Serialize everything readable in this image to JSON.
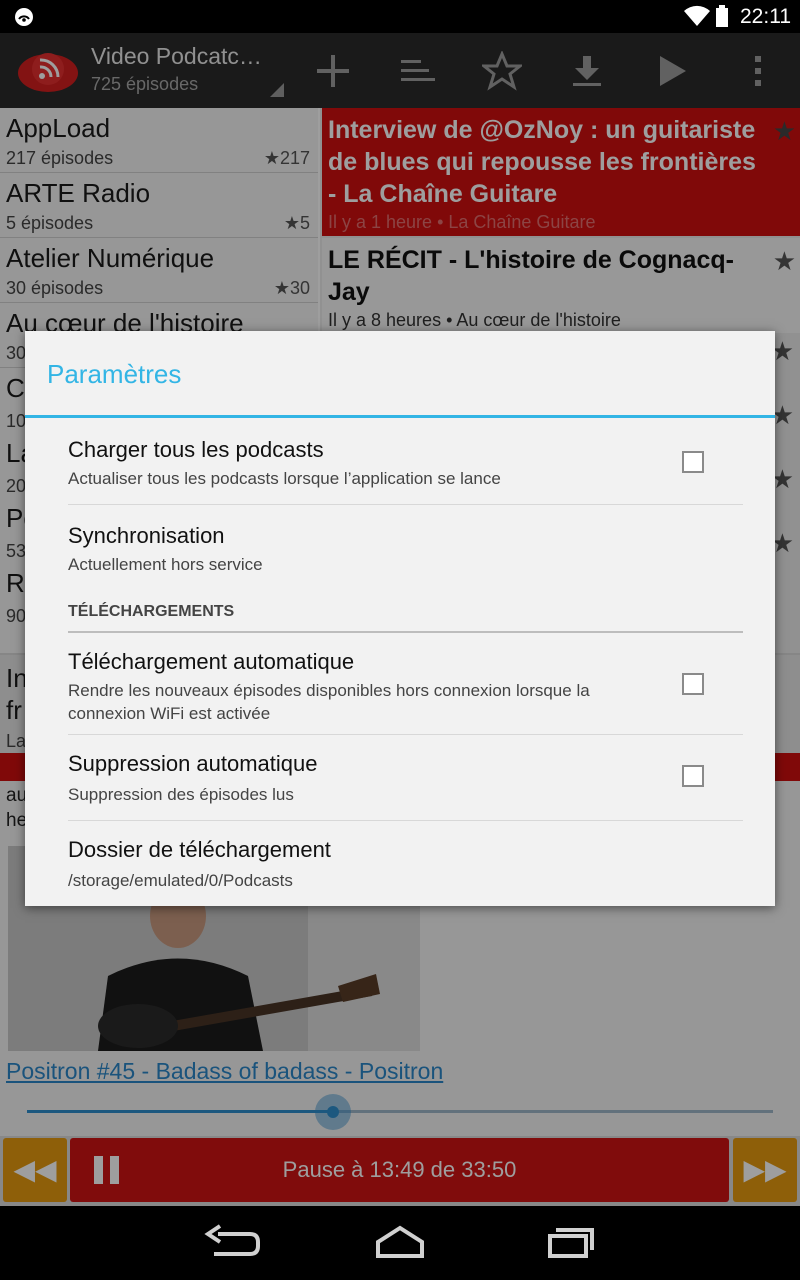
{
  "status_bar": {
    "time": "22:11"
  },
  "action_bar": {
    "title": "Video Podcatc…",
    "subtitle": "725 épisodes",
    "actions": [
      "add-icon",
      "sort-icon",
      "star-icon",
      "download-icon",
      "play-icon",
      "overflow-menu-icon"
    ]
  },
  "podcasts": [
    {
      "name": "AppLoad",
      "count": "217 épisodes",
      "stars": "★217"
    },
    {
      "name": "ARTE Radio",
      "count": "5 épisodes",
      "stars": "★5"
    },
    {
      "name": "Atelier Numérique",
      "count": "30 épisodes",
      "stars": "★30"
    },
    {
      "name": "Au cœur de l'histoire",
      "count": "30",
      "stars": ""
    }
  ],
  "peek_left": [
    "C",
    "La",
    "Po",
    "Ro",
    "In",
    "fr",
    "La",
    "au",
    "he"
  ],
  "peek_left_small": [
    "10",
    "20",
    "53",
    "90"
  ],
  "episodes": [
    {
      "title": "Interview de @OzNoy : un guitariste de blues qui repousse les frontières - La Chaîne Guitare",
      "meta": "Il y a 1 heure • La Chaîne Guitare"
    },
    {
      "title": "LE RÉCIT - L'histoire de Cognacq-Jay",
      "meta": "Il y a 8 heures • Au cœur de l'histoire"
    }
  ],
  "player": {
    "now_playing": "Positron #45 - Badass of badass - Positron",
    "progress": 0.41,
    "pause_label": "Pause à 13:49 de 33:50"
  },
  "dialog": {
    "title": "Paramètres",
    "prefs": [
      {
        "title": "Charger tous les podcasts",
        "summary": "Actualiser tous les podcasts lorsque l’application se lance",
        "checked": false
      },
      {
        "title": "Synchronisation",
        "summary": "Actuellement hors service"
      },
      {
        "title": "Téléchargement automatique",
        "summary": "Rendre les nouveaux épisodes disponibles hors connexion lorsque la connexion WiFi est activée",
        "checked": false
      },
      {
        "title": "Suppression automatique",
        "summary": "Suppression des épisodes lus",
        "checked": false
      },
      {
        "title": "Dossier de téléchargement",
        "summary": "/storage/emulated/0/Podcasts"
      }
    ],
    "category": "TÉLÉCHARGEMENTS"
  },
  "colors": {
    "accent": "#33b5e5",
    "brand_red": "#cf1010",
    "orange": "#e69a0f"
  }
}
